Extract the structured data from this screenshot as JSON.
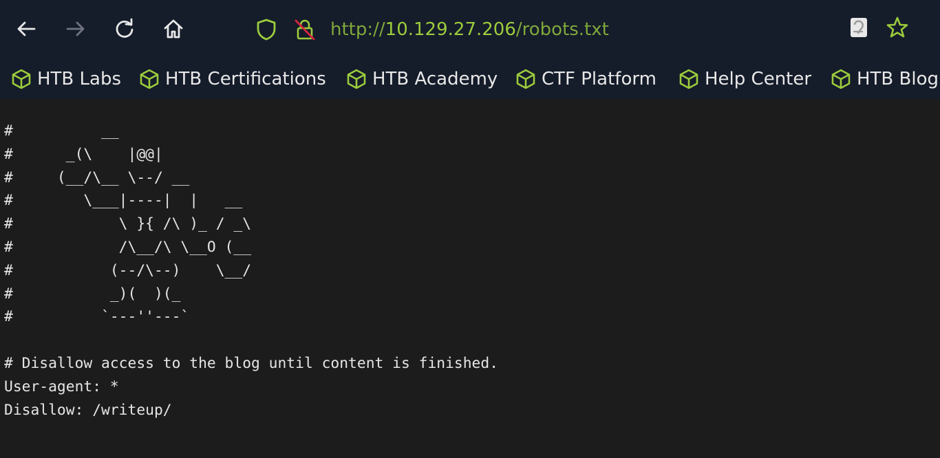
{
  "toolbar": {
    "back_icon": "arrow-left-icon",
    "forward_icon": "arrow-right-icon",
    "reload_icon": "reload-icon",
    "home_icon": "home-icon",
    "shield_icon": "shield-icon",
    "insecure_lock_icon": "insecure-lock-icon",
    "url_scheme": "http://",
    "url_host": "10.129.27.206",
    "url_path": "/robots.txt",
    "reader_icon": "reader-view-icon",
    "bookmark_star_icon": "star-icon"
  },
  "bookmarks": [
    {
      "label": "HTB Labs",
      "icon": "cube-icon"
    },
    {
      "label": "HTB Certifications",
      "icon": "cube-icon"
    },
    {
      "label": "HTB Academy",
      "icon": "cube-icon"
    },
    {
      "label": "CTF Platform",
      "icon": "cube-icon"
    },
    {
      "label": "Help Center",
      "icon": "cube-icon"
    },
    {
      "label": "HTB Blog",
      "icon": "cube-icon"
    }
  ],
  "colors": {
    "chrome_bg": "#151c2a",
    "page_bg": "#1c1c1c",
    "accent_green": "#9ccc3c",
    "url_green": "#7fa83a",
    "insecure_red": "#d7263d",
    "text": "#e6e6e6"
  },
  "page": {
    "robots_txt": "#          __\n#      _(\\    |@@|\n#     (__/\\__ \\--/ __\n#        \\___|----|  |   __\n#            \\ }{ /\\ )_ / _\\\n#            /\\__/\\ \\__O (__\n#           (--/\\--)    \\__/\n#           _)(  )(_\n#          `---''---`\n\n# Disallow access to the blog until content is finished.\nUser-agent: *\nDisallow: /writeup/"
  }
}
